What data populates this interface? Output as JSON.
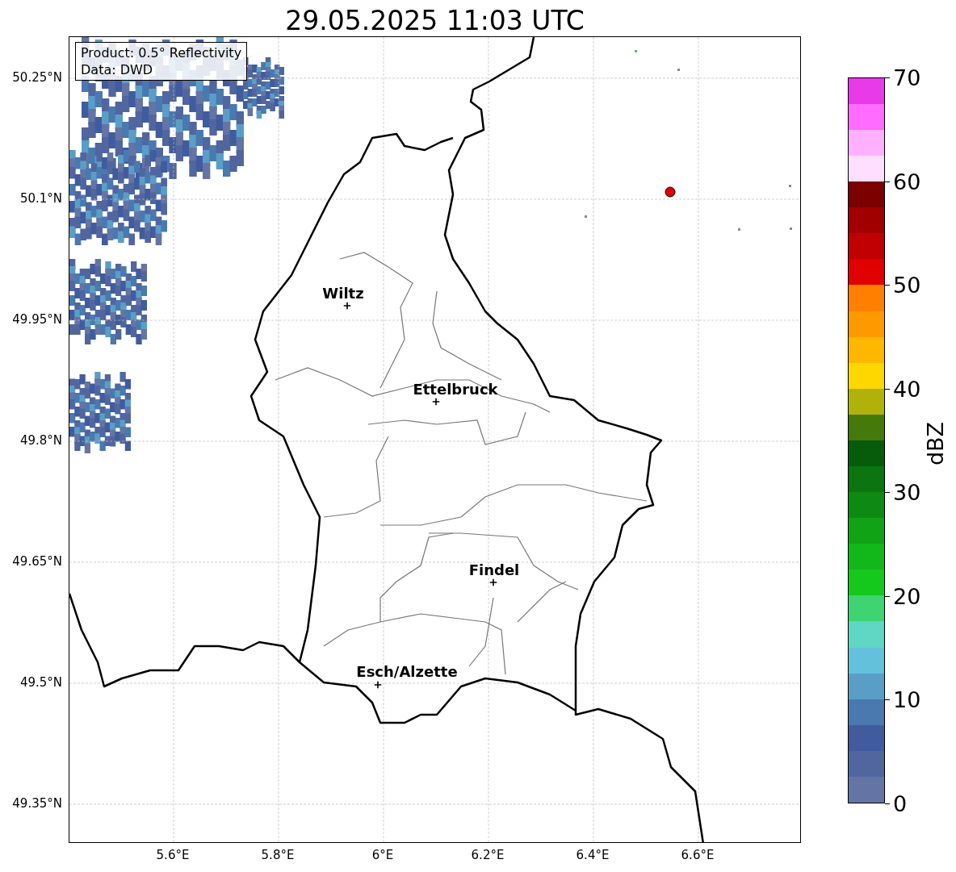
{
  "title": "29.05.2025 11:03 UTC",
  "map": {
    "info_box": [
      "Product: 0.5° Reflectivity",
      "Data: DWD"
    ],
    "places": [
      {
        "name": "Wiltz"
      },
      {
        "name": "Ettelbruck"
      },
      {
        "name": "Findel"
      },
      {
        "name": "Esch/Alzette"
      }
    ],
    "y_ticks": [
      "50.25°N",
      "50.1°N",
      "49.95°N",
      "49.8°N",
      "49.65°N",
      "49.5°N",
      "49.35°N"
    ],
    "x_ticks": [
      "5.6°E",
      "5.8°E",
      "6°E",
      "6.2°E",
      "6.4°E",
      "6.6°E"
    ]
  },
  "colorbar": {
    "label": "dBZ",
    "ticks": [
      "70",
      "60",
      "50",
      "40",
      "30",
      "20",
      "10",
      "0"
    ],
    "bins": [
      {
        "color": "#6474a4"
      },
      {
        "color": "#51669f"
      },
      {
        "color": "#405c9e"
      },
      {
        "color": "#4a79b0"
      },
      {
        "color": "#5a9ec7"
      },
      {
        "color": "#63c1dc"
      },
      {
        "color": "#60d6c4"
      },
      {
        "color": "#3dd471"
      },
      {
        "color": "#14c81c"
      },
      {
        "color": "#12b81a"
      },
      {
        "color": "#10a315"
      },
      {
        "color": "#0e8a12"
      },
      {
        "color": "#0b750f"
      },
      {
        "color": "#075c0c"
      },
      {
        "color": "#45790a"
      },
      {
        "color": "#b0b20a"
      },
      {
        "color": "#ffd700"
      },
      {
        "color": "#ffb700"
      },
      {
        "color": "#ff9900"
      },
      {
        "color": "#ff7f00"
      },
      {
        "color": "#e00000"
      },
      {
        "color": "#c00000"
      },
      {
        "color": "#a00000"
      },
      {
        "color": "#7c0000"
      },
      {
        "color": "#ffdfff"
      },
      {
        "color": "#ffb0ff"
      },
      {
        "color": "#ff6cff"
      },
      {
        "color": "#e83ae8"
      }
    ]
  }
}
